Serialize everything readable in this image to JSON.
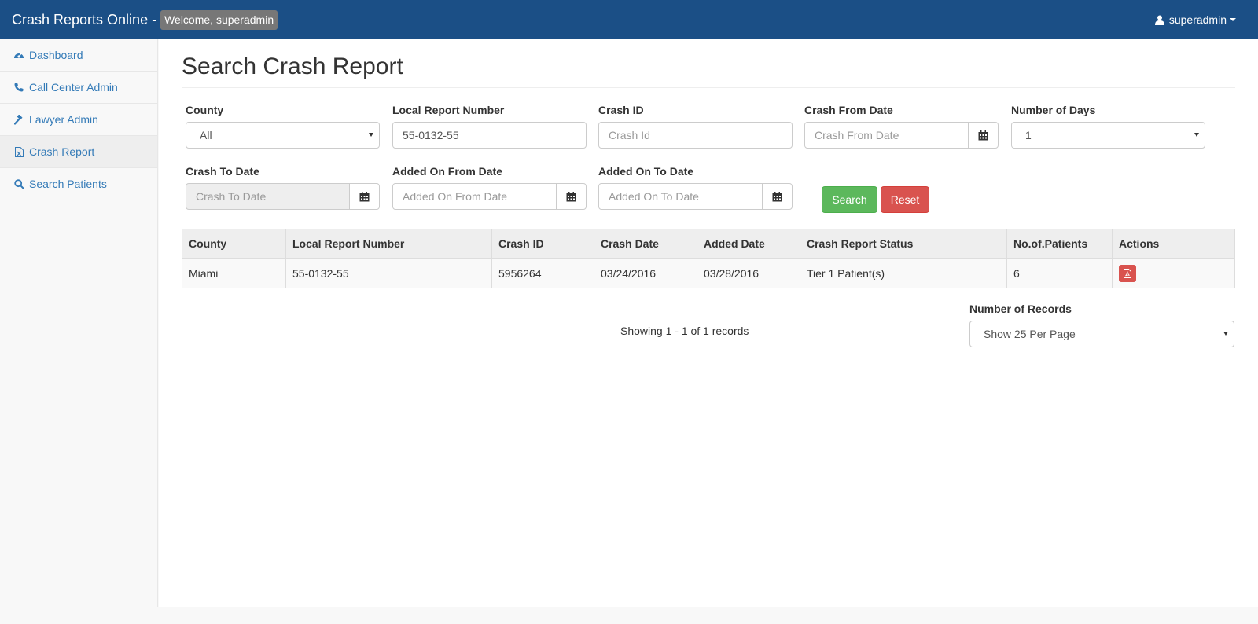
{
  "navbar": {
    "brand": "Crash Reports Online -",
    "welcome": "Welcome, superadmin",
    "user": "superadmin"
  },
  "sidebar": {
    "items": [
      {
        "label": "Dashboard",
        "icon": "dashboard-icon"
      },
      {
        "label": "Call Center Admin",
        "icon": "phone-icon"
      },
      {
        "label": "Lawyer Admin",
        "icon": "gavel-icon"
      },
      {
        "label": "Crash Report",
        "icon": "file-excel-icon"
      },
      {
        "label": "Search Patients",
        "icon": "search-icon"
      }
    ],
    "active": "Crash Report"
  },
  "page": {
    "title": "Search Crash Report"
  },
  "form": {
    "county": {
      "label": "County",
      "value": "All"
    },
    "local_report_number": {
      "label": "Local Report Number",
      "value": "55-0132-55"
    },
    "crash_id": {
      "label": "Crash ID",
      "placeholder": "Crash Id"
    },
    "crash_from_date": {
      "label": "Crash From Date",
      "placeholder": "Crash From Date"
    },
    "number_of_days": {
      "label": "Number of Days",
      "value": "1"
    },
    "crash_to_date": {
      "label": "Crash To Date",
      "placeholder": "Crash To Date"
    },
    "added_on_from_date": {
      "label": "Added On From Date",
      "placeholder": "Added On From Date"
    },
    "added_on_to_date": {
      "label": "Added On To Date",
      "placeholder": "Added On To Date"
    },
    "search_label": "Search",
    "reset_label": "Reset"
  },
  "table": {
    "columns": [
      "County",
      "Local Report Number",
      "Crash ID",
      "Crash Date",
      "Added Date",
      "Crash Report Status",
      "No.of.Patients",
      "Actions"
    ],
    "rows": [
      {
        "county": "Miami",
        "local_report_number": "55-0132-55",
        "crash_id": "5956264",
        "crash_date": "03/24/2016",
        "added_date": "03/28/2016",
        "status": "Tier 1 Patient(s)",
        "patients": "6",
        "action_icon": "pdf-icon"
      }
    ]
  },
  "pagination": {
    "showing": "Showing 1 - 1 of 1 records",
    "records_label": "Number of Records",
    "records_value": "Show 25 Per Page"
  },
  "colors": {
    "navbar": "#1b4f86",
    "link": "#337ab7",
    "success": "#5cb85c",
    "danger": "#d9534f"
  }
}
